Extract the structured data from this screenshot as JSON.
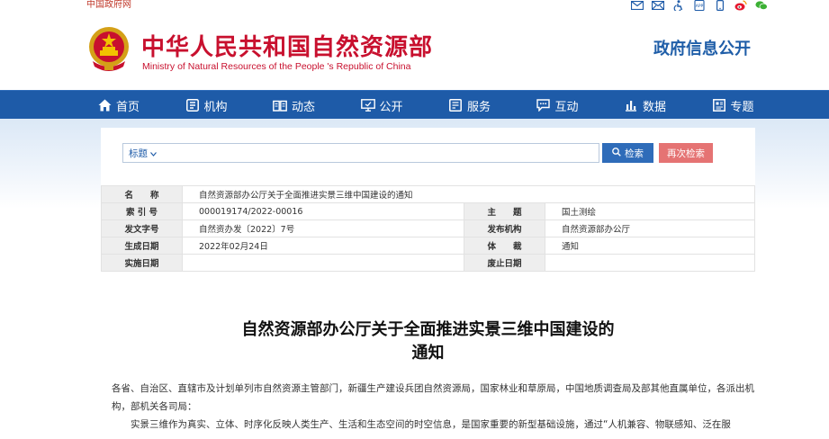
{
  "topbar": {
    "gov_link": "中国政府网",
    "icons": [
      "mail-icon",
      "mail-alt-icon",
      "accessibility-icon",
      "app-icon",
      "mobile-icon",
      "weibo-icon",
      "wechat-icon"
    ]
  },
  "header": {
    "title": "中华人民共和国自然资源部",
    "subtitle": "Ministry of Natural Resources of the People 's Republic of China",
    "gov_info": "政府信息公开"
  },
  "nav": {
    "items": [
      {
        "label": "首页",
        "icon": "home-icon"
      },
      {
        "label": "机构",
        "icon": "institution-icon"
      },
      {
        "label": "动态",
        "icon": "news-icon"
      },
      {
        "label": "公开",
        "icon": "disclosure-icon"
      },
      {
        "label": "服务",
        "icon": "service-icon"
      },
      {
        "label": "互动",
        "icon": "interaction-icon"
      },
      {
        "label": "数据",
        "icon": "data-icon"
      },
      {
        "label": "专题",
        "icon": "topic-icon"
      }
    ]
  },
  "search": {
    "select_label": "标题",
    "placeholder": "",
    "search_label": "检索",
    "restrict_label": "再次检索"
  },
  "meta": {
    "name_label": "名　　称",
    "name_value": "自然资源部办公厅关于全面推进实景三维中国建设的通知",
    "index_label": "索 引 号",
    "index_value": "000019174/2022-00016",
    "topic_label": "主　　题",
    "topic_value": "国土测绘",
    "doc_no_label": "发文字号",
    "doc_no_value": "自然资办发〔2022〕7号",
    "publisher_label": "发布机构",
    "publisher_value": "自然资源部办公厅",
    "date_label": "生成日期",
    "date_value": "2022年02月24日",
    "genre_label": "体　　裁",
    "genre_value": "通知",
    "effective_label": "实施日期",
    "effective_value": "",
    "repeal_label": "废止日期",
    "repeal_value": ""
  },
  "article": {
    "title_line1": "自然资源部办公厅关于全面推进实景三维中国建设的",
    "title_line2": "通知",
    "recipients": "各省、自治区、直辖市及计划单列市自然资源主管部门，新疆生产建设兵团自然资源局，国家林业和草原局，中国地质调查局及部其他直属单位，各派出机构，部机关各司局：",
    "para1": "实景三维作为真实、立体、时序化反映人类生产、生活和生态空间的时空信息，是国家重要的新型基础设施，通过“人机兼容、物联感知、泛在服"
  },
  "colors": {
    "brand_red": "#c8102e",
    "nav_blue": "#1e5ba8",
    "search_blue": "#2f6cb9",
    "restrict_red": "#e57373"
  }
}
